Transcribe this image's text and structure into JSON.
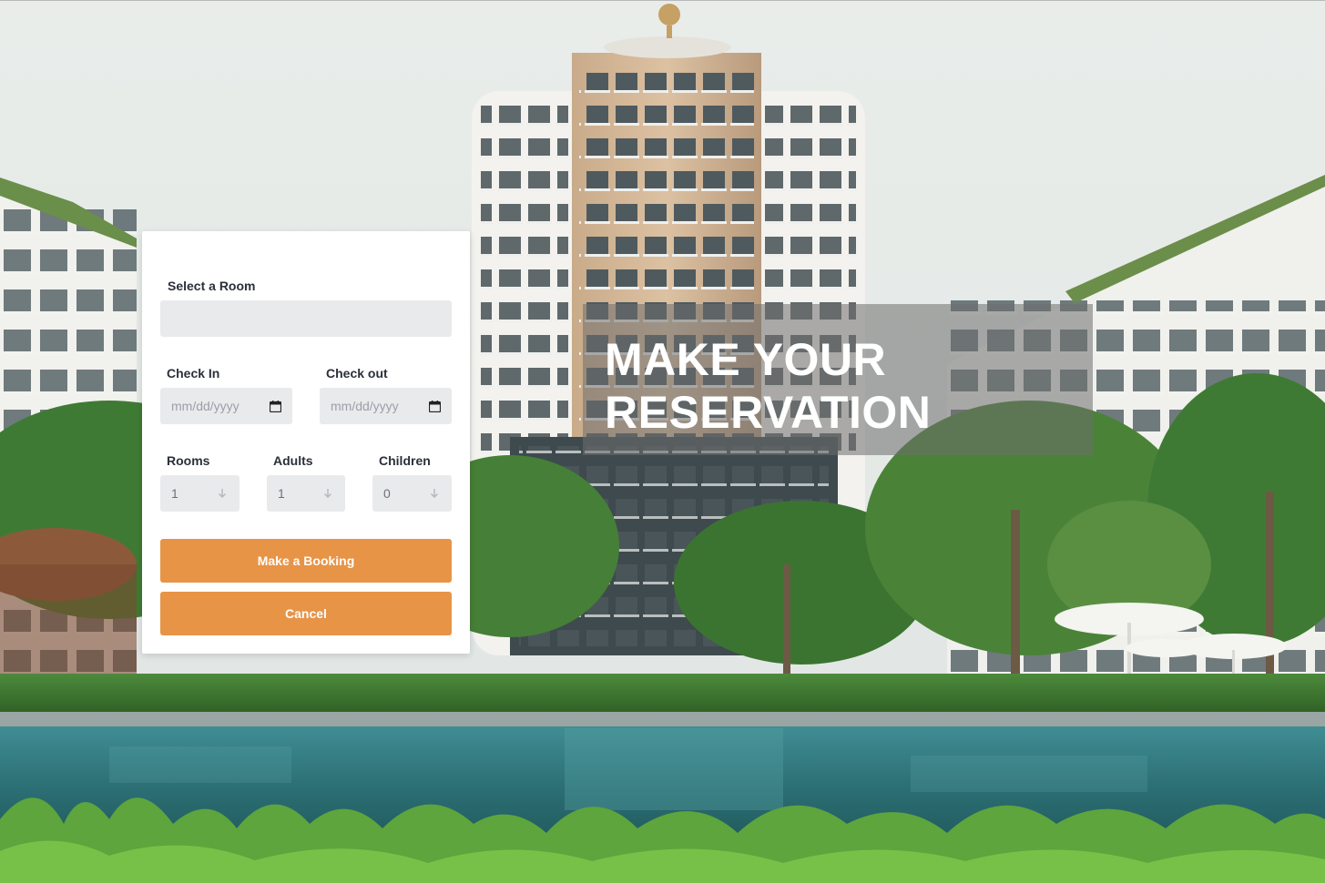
{
  "headline": {
    "line1": "MAKE YOUR",
    "line2": "RESERVATION"
  },
  "booking_form": {
    "room": {
      "label": "Select a Room",
      "value": ""
    },
    "check_in": {
      "label": "Check In",
      "placeholder": "mm/dd/yyyy",
      "icon": "calendar-icon"
    },
    "check_out": {
      "label": "Check out",
      "placeholder": "mm/dd/yyyy",
      "icon": "calendar-icon"
    },
    "rooms": {
      "label": "Rooms",
      "value": "1",
      "icon": "arrow-down-icon"
    },
    "adults": {
      "label": "Adults",
      "value": "1",
      "icon": "arrow-down-icon"
    },
    "children": {
      "label": "Children",
      "value": "0",
      "icon": "arrow-down-icon"
    },
    "submit_label": "Make a Booking",
    "cancel_label": "Cancel"
  },
  "colors": {
    "accent": "#e79447",
    "field_bg": "#e9eaec",
    "label_text": "#2b2f3a"
  }
}
